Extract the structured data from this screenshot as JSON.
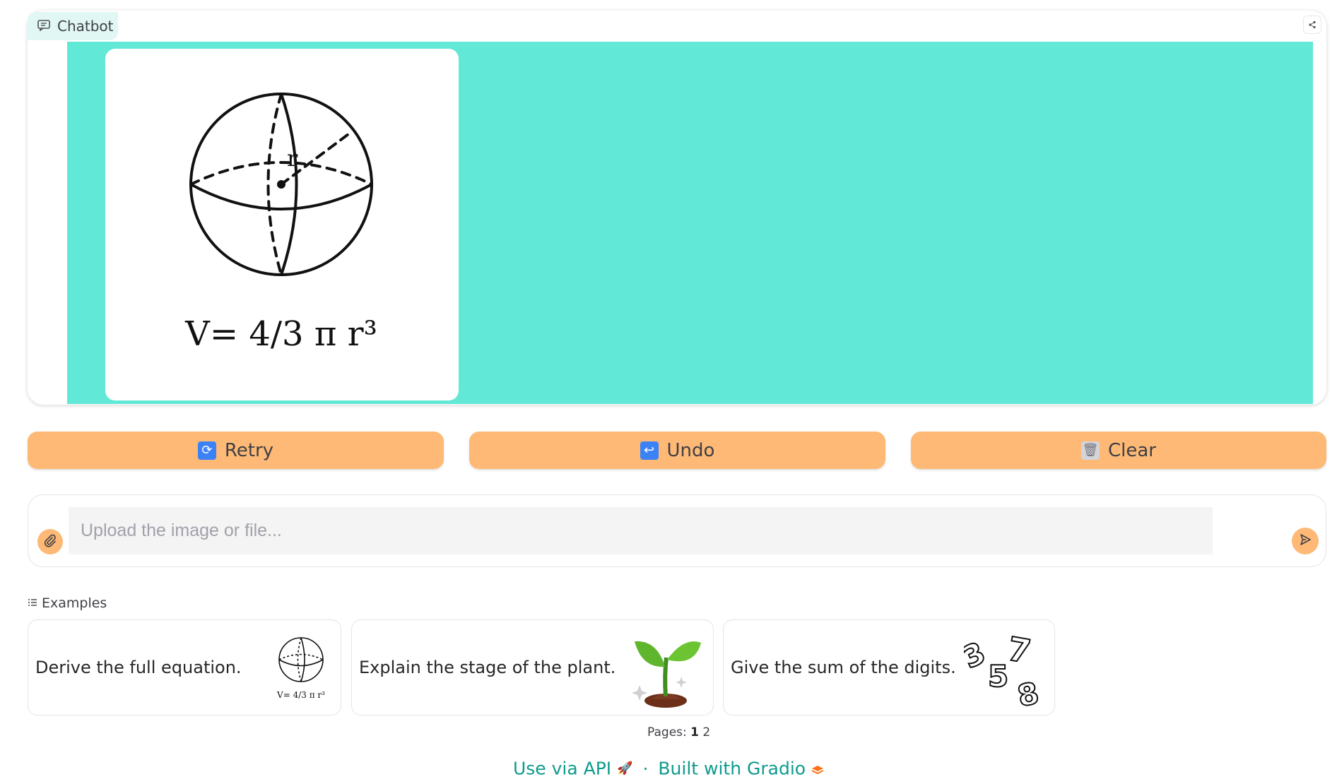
{
  "chatbot": {
    "label": "Chatbot",
    "label_icon": "chat-bubble-icon",
    "share_icon": "share-icon",
    "message_image": {
      "formula": "V= 4/3 π r³",
      "radius_label": "r"
    }
  },
  "actions": {
    "retry": {
      "label": "Retry",
      "icon": "retry-icon"
    },
    "undo": {
      "label": "Undo",
      "icon": "undo-icon"
    },
    "clear": {
      "label": "Clear",
      "icon": "trash-icon"
    }
  },
  "input": {
    "placeholder": "Upload the image or file...",
    "value": "",
    "attach_icon": "paperclip-icon",
    "send_icon": "send-icon"
  },
  "examples": {
    "label": "Examples",
    "items": [
      {
        "text": "Derive the full equation.",
        "thumb": "sphere-volume"
      },
      {
        "text": "Explain the stage of the plant.",
        "thumb": "sprout"
      },
      {
        "text": "Give the sum of the digits.",
        "thumb": "digits"
      }
    ],
    "pages_label": "Pages:",
    "pages": [
      "1",
      "2"
    ]
  },
  "footer": {
    "api_link": "Use via API",
    "separator": "·",
    "built_with": "Built with Gradio"
  },
  "colors": {
    "accent": "#fdb975",
    "chat_bg": "#62e8d6",
    "link": "#0f9b8e"
  }
}
